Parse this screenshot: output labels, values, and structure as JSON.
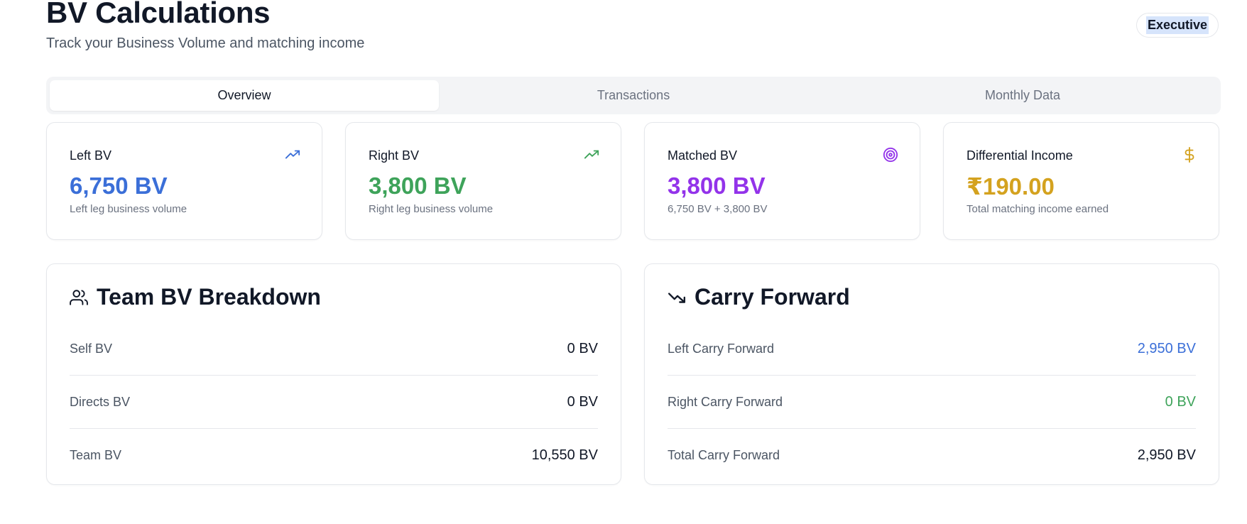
{
  "header": {
    "title": "BV Calculations",
    "subtitle": "Track your Business Volume and matching income",
    "rank_badge": "Executive"
  },
  "tabs": [
    {
      "label": "Overview",
      "active": true
    },
    {
      "label": "Transactions",
      "active": false
    },
    {
      "label": "Monthly Data",
      "active": false
    }
  ],
  "stats": [
    {
      "label": "Left BV",
      "value": "6,750 BV",
      "desc": "Left leg business volume",
      "icon": "trending-up-icon",
      "color": "#3b6fd8"
    },
    {
      "label": "Right BV",
      "value": "3,800 BV",
      "desc": "Right leg business volume",
      "icon": "trending-up-icon",
      "color": "#3ea35a"
    },
    {
      "label": "Matched BV",
      "value": "3,800 BV",
      "desc": "6,750 BV + 3,800 BV",
      "icon": "target-icon",
      "color": "#9333ea"
    },
    {
      "label": "Differential Income",
      "value": "₹190.00",
      "desc": "Total matching income earned",
      "icon": "dollar-icon",
      "color": "#d4a21f"
    }
  ],
  "team_breakdown": {
    "title": "Team BV Breakdown",
    "icon": "users-icon",
    "rows": [
      {
        "label": "Self BV",
        "value": "0 BV"
      },
      {
        "label": "Directs BV",
        "value": "0 BV"
      },
      {
        "label": "Team BV",
        "value": "10,550 BV"
      }
    ]
  },
  "carry_forward": {
    "title": "Carry Forward",
    "icon": "trending-down-icon",
    "rows": [
      {
        "label": "Left Carry Forward",
        "value": "2,950 BV",
        "color": "#3b6fd8"
      },
      {
        "label": "Right Carry Forward",
        "value": "0 BV",
        "color": "#3ea35a"
      },
      {
        "label": "Total Carry Forward",
        "value": "2,950 BV",
        "color": "#111827"
      }
    ]
  }
}
